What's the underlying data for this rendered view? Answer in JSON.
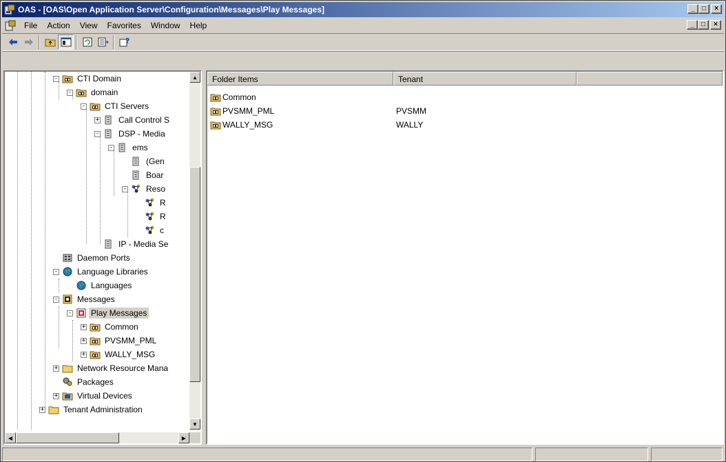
{
  "window": {
    "title": "OAS - [OAS\\Open Application Server\\Configuration\\Messages\\Play Messages]",
    "caption_buttons": {
      "minimize": "_",
      "maximize": "□",
      "close": "×"
    }
  },
  "menubar": {
    "items": [
      {
        "label": "File"
      },
      {
        "label": "Action"
      },
      {
        "label": "View"
      },
      {
        "label": "Favorites"
      },
      {
        "label": "Window"
      },
      {
        "label": "Help"
      }
    ]
  },
  "toolbar": {
    "buttons": [
      "back-arrow-icon",
      "forward-arrow-icon",
      "up-folder-icon",
      "show-tree-icon",
      "refresh-icon",
      "export-list-icon",
      "help-icon"
    ]
  },
  "tree": {
    "items": [
      {
        "label": "CTI Domain"
      },
      {
        "label": "domain"
      },
      {
        "label": "CTI Servers"
      },
      {
        "label": "Call Control S"
      },
      {
        "label": "DSP - Media"
      },
      {
        "label": "ems"
      },
      {
        "label": "(Gen"
      },
      {
        "label": "Boar"
      },
      {
        "label": "Reso"
      },
      {
        "label": "R"
      },
      {
        "label": "R"
      },
      {
        "label": "c"
      },
      {
        "label": "IP - Media Se"
      },
      {
        "label": "Daemon Ports"
      },
      {
        "label": "Language Libraries"
      },
      {
        "label": "Languages"
      },
      {
        "label": "Messages"
      },
      {
        "label": "Play Messages"
      },
      {
        "label": "Common"
      },
      {
        "label": "PVSMM_PML"
      },
      {
        "label": "WALLY_MSG"
      },
      {
        "label": "Network Resource Mana"
      },
      {
        "label": "Packages"
      },
      {
        "label": "Virtual Devices"
      },
      {
        "label": "Tenant Administration"
      }
    ]
  },
  "list": {
    "columns": [
      "Folder Items",
      "Tenant",
      ""
    ],
    "rows": [
      {
        "name": "Common",
        "tenant": ""
      },
      {
        "name": "PVSMM_PML",
        "tenant": "PVSMM"
      },
      {
        "name": "WALLY_MSG",
        "tenant": "WALLY"
      }
    ]
  },
  "colors": {
    "title_start": "#0a246a",
    "title_end": "#a6caf0",
    "face": "#d4d0c8",
    "folder": "#e8c060"
  }
}
